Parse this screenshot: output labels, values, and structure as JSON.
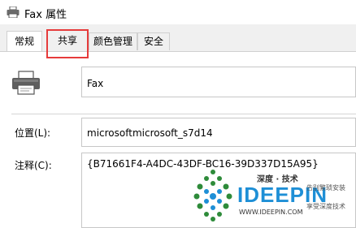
{
  "window": {
    "title": "Fax 属性"
  },
  "tabs": [
    {
      "label": "常规"
    },
    {
      "label": "共享"
    },
    {
      "label": "颜色管理"
    },
    {
      "label": "安全"
    }
  ],
  "general": {
    "printer_name": "Fax",
    "location_label": "位置(L):",
    "location_value": "microsoftmicrosoft_s7d14",
    "comment_label": "注释(C):",
    "comment_value": "{B71661F4-A4DC-43DF-BC16-39D337D15A95}"
  },
  "watermark": {
    "tagline": "深度 · 技术",
    "brand": "IDEEPIN",
    "url": "WWW.IDEEPIN.COM",
    "side_text_1": "告别繁琐安装",
    "side_text_2": "享受深度技术"
  },
  "colors": {
    "highlight": "#e63b3b",
    "brand": "#1e8fd6"
  }
}
